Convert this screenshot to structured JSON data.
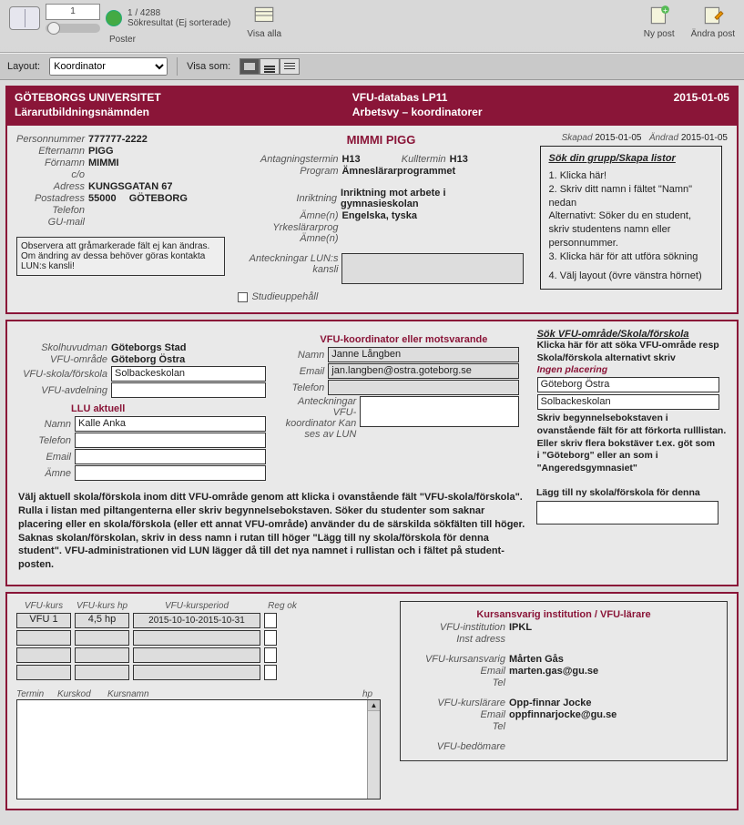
{
  "toolbar": {
    "record_current": "1",
    "record_count": "1 / 4288",
    "search_status": "Sökresultat (Ej sorterade)",
    "posts_label": "Poster",
    "show_all": "Visa alla",
    "new_post": "Ny post",
    "edit_post": "Ändra post"
  },
  "layoutbar": {
    "layout_label": "Layout:",
    "layout_value": "Koordinator",
    "view_label": "Visa som:"
  },
  "header": {
    "uni": "GÖTEBORGS UNIVERSITET",
    "board": "Lärarutbildningsnämnden",
    "db": "VFU-databas LP11",
    "view": "Arbetsvy – koordinatorer",
    "date": "2015-01-05"
  },
  "person": {
    "name_title": "MIMMI PIGG",
    "pnr_label": "Personnummer",
    "pnr": "777777-2222",
    "lastname_label": "Efternamn",
    "lastname": "PIGG",
    "firstname_label": "Förnamn",
    "firstname": "MIMMI",
    "co_label": "c/o",
    "address_label": "Adress",
    "address": "KUNGSGATAN 67",
    "post_label": "Postadress",
    "post_zip": "55000",
    "post_city": "GÖTEBORG",
    "phone_label": "Telefon",
    "gumail_label": "GU-mail",
    "locknote": "Observera att gråmarkerade fält ej kan ändras. Om ändring av dessa behöver göras kontakta LUN:s kansli!",
    "skapad_lbl": "Skapad",
    "skapad": "2015-01-05",
    "andrad_lbl": "Ändrad",
    "andrad": "2015-01-05"
  },
  "prog": {
    "antag_lbl": "Antagningstermin",
    "antag": "H13",
    "kull_lbl": "Kulltermin",
    "kull": "H13",
    "program_lbl": "Program",
    "program": "Ämneslärarprogrammet",
    "inrikt_lbl": "Inriktning",
    "inrikt": "Inriktning mot arbete i gymnasieskolan",
    "amnen_lbl": "Ämne(n)",
    "amnen": "Engelska, tyska",
    "yrk_lbl": "Yrkeslärarprog Ämne(n)",
    "anteck_lbl": "Anteckningar LUN:s kansli",
    "studie_lbl": "Studieuppehåll"
  },
  "sokgrupp": {
    "title": "Sök din grupp/Skapa listor",
    "l1": "1. Klicka här!",
    "l2": "2. Skriv ditt namn i fältet \"Namn\" nedan",
    "l2b": "Alternativt: Söker du en student, skriv studentens namn eller personnummer.",
    "l3": "3. Klicka här för att utföra sökning",
    "l4": "4. Välj layout (övre vänstra hörnet)"
  },
  "place": {
    "huvud_lbl": "Skolhuvudman",
    "huvud": "Göteborgs Stad",
    "omrade_lbl": "VFU-område",
    "omrade": "Göteborg Östra",
    "skola_lbl": "VFU-skola/förskola",
    "skola": "Solbackeskolan",
    "avd_lbl": "VFU-avdelning",
    "llu_title": "LLU aktuell",
    "llu_namn_lbl": "Namn",
    "llu_namn": "Kalle Anka",
    "llu_tel_lbl": "Telefon",
    "llu_email_lbl": "Email",
    "llu_amne_lbl": "Ämne"
  },
  "koord": {
    "title": "VFU-koordinator eller motsvarande",
    "namn_lbl": "Namn",
    "namn": "Janne Långben",
    "email_lbl": "Email",
    "email": "jan.langben@ostra.goteborg.se",
    "tel_lbl": "Telefon",
    "ant_lbl": "Anteckningar VFU-koordinator Kan ses av LUN"
  },
  "sokomrade": {
    "title": "Sök VFU-område/Skola/förskola",
    "p1": "Klicka här för att söka VFU-område resp Skola/förskola alternativt skriv",
    "p1b": "Ingen placering",
    "f1": "Göteborg Östra",
    "f2": "Solbackeskolan",
    "p2": "Skriv begynnelsebokstaven i ovanstående fält för att förkorta rulllistan. Eller skriv flera bokstäver t.ex. göt som",
    "p3": "i \"Göteborg\" eller an som i \"Angeredsgymnasiet\"",
    "add_lbl": "Lägg till ny skola/förskola för denna"
  },
  "bigtext": "Välj aktuell skola/förskola inom ditt VFU-område genom att klicka i ovanstående fält \"VFU-skola/förskola\". Rulla i listan med piltangenterna eller skriv begynnelsebokstaven. Söker du studenter som saknar placering eller en skola/förskola (eller ett annat VFU-område) använder du de särskilda sökfälten till höger. Saknas skolan/förskolan, skriv in dess namn i rutan till höger \"Lägg till ny skola/förskola för denna student\". VFU-administrationen vid LUN lägger då till det nya namnet i rullistan och i fältet på student-posten.",
  "kurs": {
    "c1": "VFU-kurs",
    "c2": "VFU-kurs hp",
    "c3": "VFU-kursperiod",
    "c4": "Reg ok",
    "r1c1": "VFU 1",
    "r1c2": "4,5 hp",
    "r1c3": "2015-10-10-2015-10-31",
    "th_termin": "Termin",
    "th_kurskod": "Kurskod",
    "th_kursnamn": "Kursnamn",
    "th_hp": "hp"
  },
  "inst": {
    "title": "Kursansvarig institution / VFU-lärare",
    "inst_lbl": "VFU-institution",
    "inst": "IPKL",
    "inst_adr_lbl": "Inst adress",
    "ansv_lbl": "VFU-kursansvarig",
    "ansv": "Mårten Gås",
    "ansv_email_lbl": "Email",
    "ansv_email": "marten.gas@gu.se",
    "ansv_tel_lbl": "Tel",
    "lar_lbl": "VFU-kurslärare",
    "lar": "Opp-finnar Jocke",
    "lar_email_lbl": "Email",
    "lar_email": "oppfinnarjocke@gu.se",
    "lar_tel_lbl": "Tel",
    "bed_lbl": "VFU-bedömare"
  }
}
